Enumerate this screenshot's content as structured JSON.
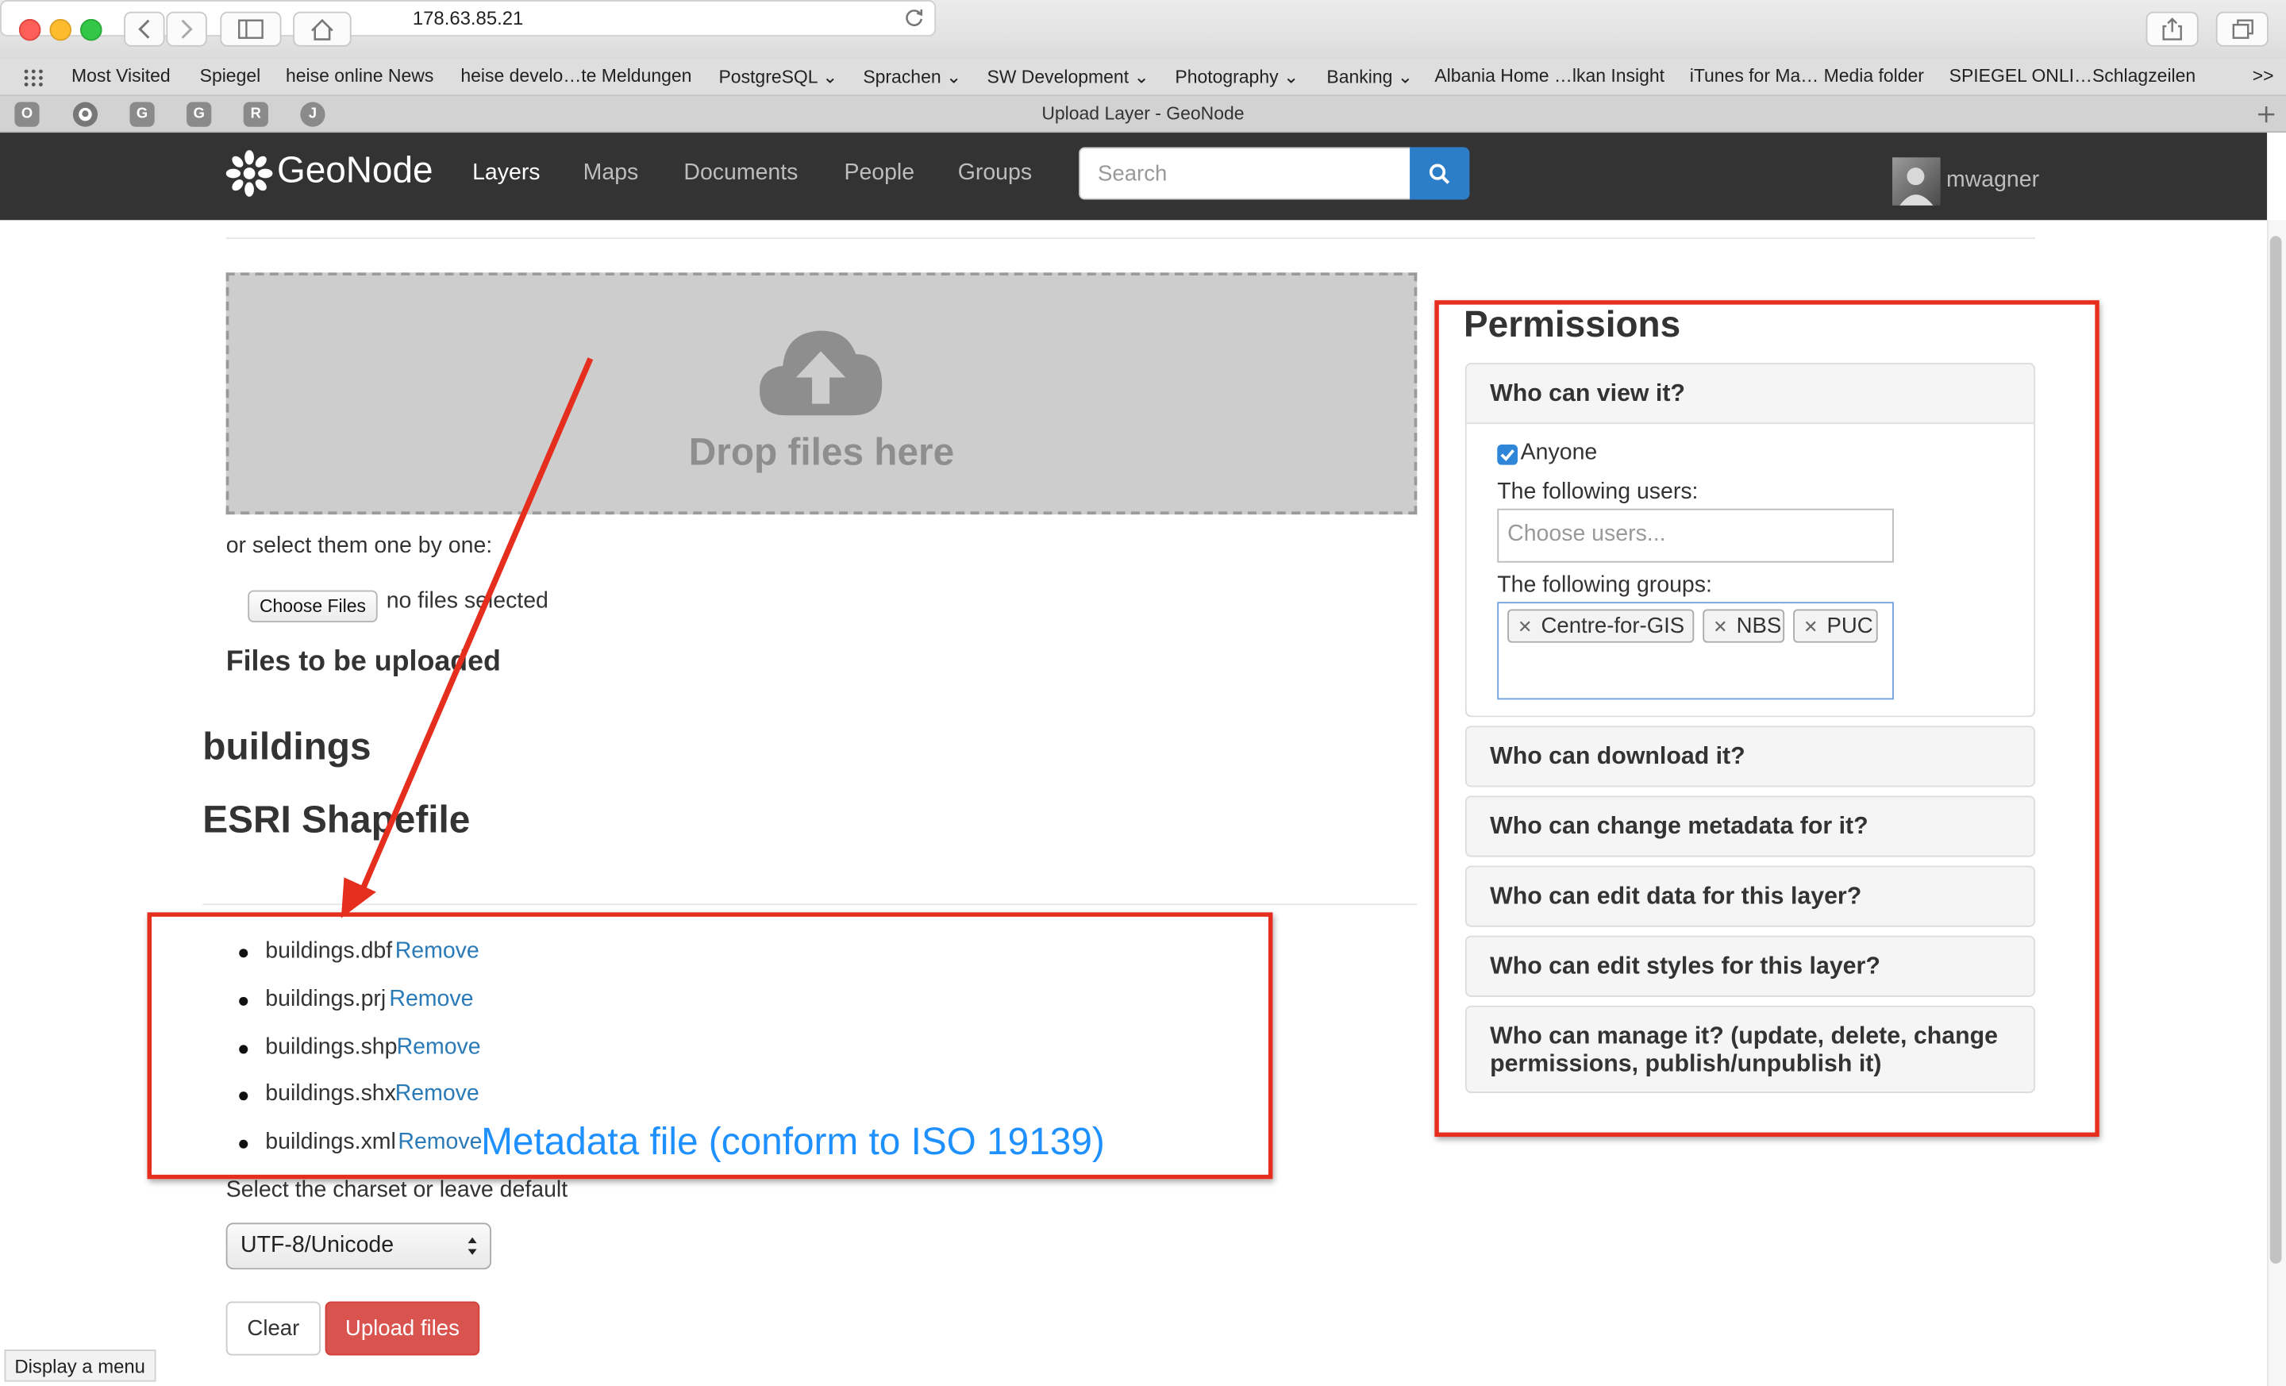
{
  "browser": {
    "url": "178.63.85.21",
    "tab_title": "Upload Layer - GeoNode",
    "bookmarks": [
      "Most Visited",
      "Spiegel",
      "heise online News",
      "heise develo…te Meldungen",
      "PostgreSQL ⌄",
      "Sprachen ⌄",
      "SW Development ⌄",
      "Photography ⌄",
      "Banking ⌄",
      "Albania Home …lkan Insight",
      "iTunes for Ma… Media folder",
      "SPIEGEL ONLI…Schlagzeilen",
      ">>"
    ],
    "pinned_tabs": [
      "O",
      "",
      "G",
      "G",
      "R",
      "J"
    ]
  },
  "navbar": {
    "brand": "GeoNode",
    "items": [
      "Layers",
      "Maps",
      "Documents",
      "People",
      "Groups"
    ],
    "search_placeholder": "Search",
    "user": "mwagner"
  },
  "upload": {
    "drop_text": "Drop files here",
    "select_text": "or select them one by one:",
    "choose_files": "Choose Files",
    "no_files": "no files selected",
    "files_heading": "Files to be uploaded",
    "layer_name": "buildings",
    "layer_type": "ESRI Shapefile",
    "files": [
      "buildings.dbf",
      "buildings.prj",
      "buildings.shp",
      "buildings.shx",
      "buildings.xml"
    ],
    "remove_label": "Remove",
    "metadata_annotation": "Metadata file (conform to ISO 19139)",
    "charset_label": "Select the charset or leave default",
    "charset_value": "UTF-8/Unicode",
    "clear_label": "Clear",
    "upload_label": "Upload files"
  },
  "permissions": {
    "title": "Permissions",
    "view": {
      "title": "Who can view it?",
      "anyone": "Anyone",
      "anyone_checked": true,
      "users_label": "The following users:",
      "users_placeholder": "Choose users...",
      "groups_label": "The following groups:",
      "groups": [
        "Centre-for-GIS",
        "NBS",
        "PUC"
      ]
    },
    "download": "Who can download it?",
    "change_metadata": "Who can change metadata for it?",
    "edit_data": "Who can edit data for this layer?",
    "edit_styles": "Who can edit styles for this layer?",
    "manage_line1": "Who can manage it? (update, delete, change",
    "manage_line2": "permissions, publish/unpublish it)"
  },
  "status_tooltip": "Display a menu",
  "colors": {
    "navbar": "#333333",
    "search_button": "#2c7ec9",
    "upload_button": "#d9534f",
    "annotation_red": "#e52e1e",
    "link": "#2a7ab8",
    "annotation_text": "#1e90ff"
  }
}
